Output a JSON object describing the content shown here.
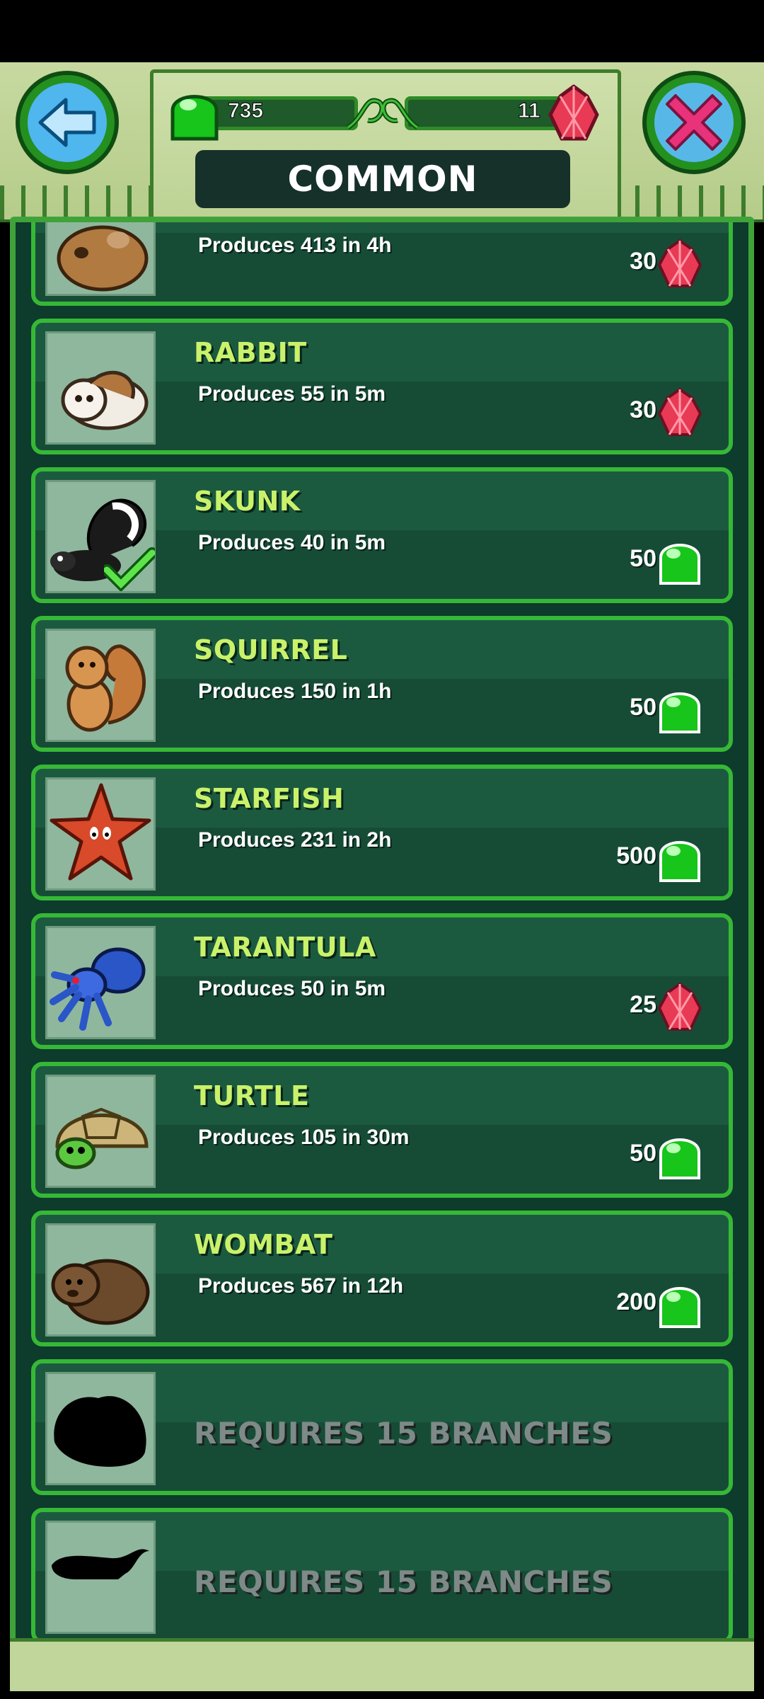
{
  "header": {
    "title": "COMMON",
    "jelly_count": "735",
    "gem_count": "11"
  },
  "colors": {
    "accent_green": "#36b836",
    "card_bg": "#1c5a40",
    "name_color": "#c9f26a",
    "jelly_green": "#1dc41c",
    "gem_red": "#e83a55"
  },
  "items": [
    {
      "name": "",
      "produces": "Produces 413 in 4h",
      "price": "30",
      "currency": "gem-icon",
      "animal": "hamster"
    },
    {
      "name": "RABBIT",
      "produces": "Produces 55 in 5m",
      "price": "30",
      "currency": "gem-icon",
      "animal": "rabbit"
    },
    {
      "name": "SKUNK",
      "produces": "Produces 40 in 5m",
      "price": "50",
      "currency": "jelly-icon",
      "animal": "skunk",
      "owned": true
    },
    {
      "name": "SQUIRREL",
      "produces": "Produces 150 in 1h",
      "price": "50",
      "currency": "jelly-icon",
      "animal": "squirrel"
    },
    {
      "name": "STARFISH",
      "produces": "Produces 231 in 2h",
      "price": "500",
      "currency": "jelly-icon",
      "animal": "starfish"
    },
    {
      "name": "TARANTULA",
      "produces": "Produces 50 in 5m",
      "price": "25",
      "currency": "gem-icon",
      "animal": "tarantula"
    },
    {
      "name": "TURTLE",
      "produces": "Produces 105 in 30m",
      "price": "50",
      "currency": "jelly-icon",
      "animal": "turtle"
    },
    {
      "name": "WOMBAT",
      "produces": "Produces 567 in 12h",
      "price": "200",
      "currency": "jelly-icon",
      "animal": "wombat"
    }
  ],
  "locked": [
    {
      "text": "REQUIRES 15 BRANCHES",
      "animal": "silhouette-creature"
    },
    {
      "text": "REQUIRES 15 BRANCHES",
      "animal": "silhouette-panther"
    }
  ]
}
